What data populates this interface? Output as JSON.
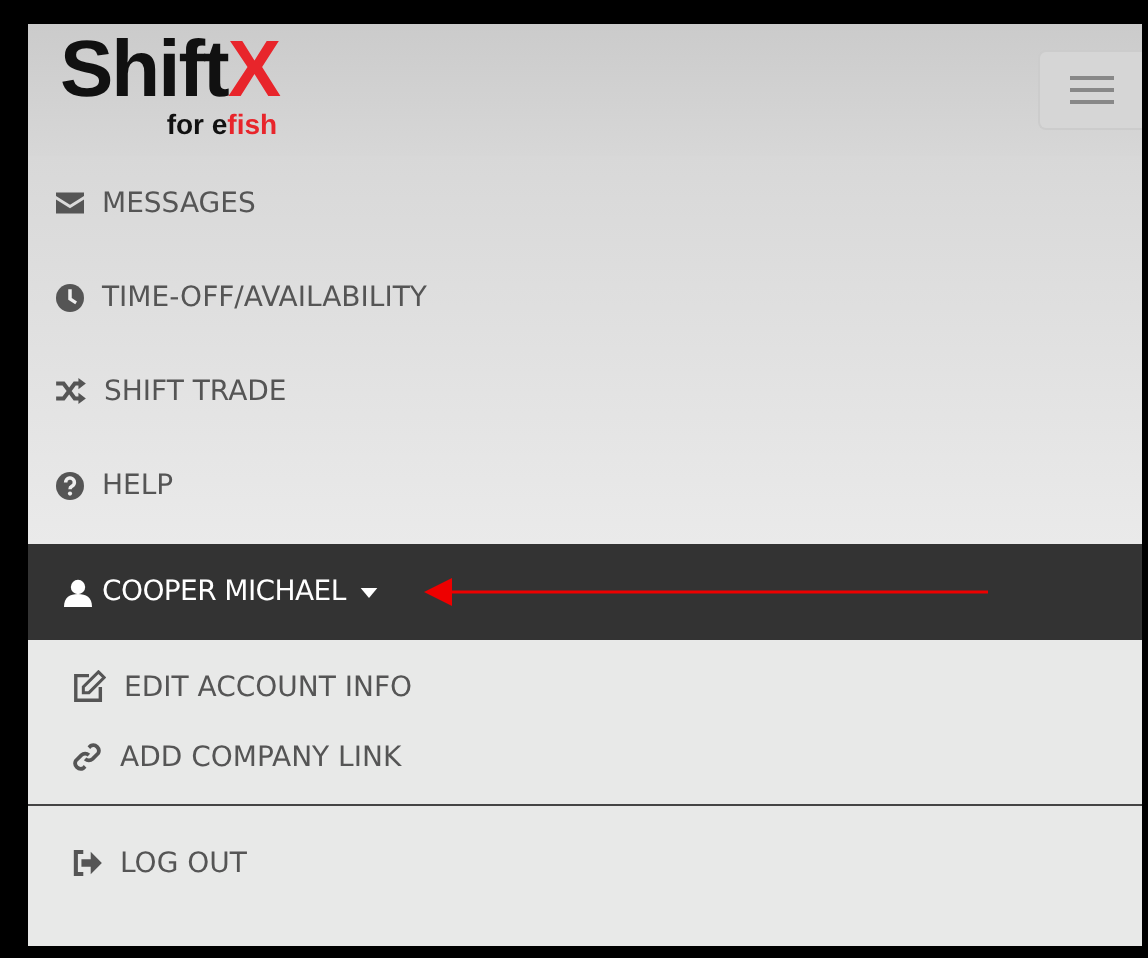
{
  "logo": {
    "name": "Shift",
    "mark": "X",
    "tagline_plain": "for e",
    "tagline_accent": "fish"
  },
  "nav": [
    {
      "kind": "envelope",
      "label": "MESSAGES"
    },
    {
      "kind": "clock",
      "label": "TIME-OFF/AVAILABILITY"
    },
    {
      "kind": "shuffle",
      "label": "SHIFT TRADE"
    },
    {
      "kind": "question",
      "label": "HELP"
    }
  ],
  "user_menu": {
    "label": "COOPER MICHAEL",
    "expanded": true,
    "items": [
      {
        "kind": "edit",
        "label": "EDIT ACCOUNT INFO"
      },
      {
        "kind": "link",
        "label": "ADD COMPANY LINK"
      }
    ],
    "footer_items": [
      {
        "kind": "logout",
        "label": "LOG OUT"
      }
    ]
  }
}
